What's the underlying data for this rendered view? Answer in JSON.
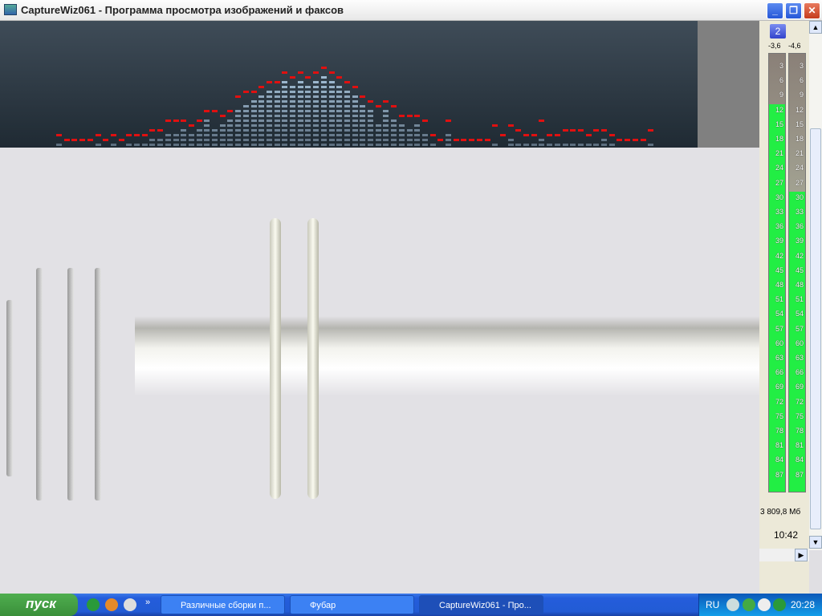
{
  "window": {
    "title": "CaptureWiz061 - Программа просмотра изображений и факсов"
  },
  "spectrum": {
    "peak_color": "#e01010",
    "bar_color": "#a8c4dc",
    "levels": [
      1,
      0,
      0,
      0,
      0,
      1,
      0,
      1,
      0,
      1,
      1,
      1,
      2,
      2,
      3,
      3,
      4,
      3,
      4,
      6,
      4,
      5,
      6,
      8,
      9,
      10,
      11,
      12,
      12,
      14,
      13,
      14,
      13,
      14,
      15,
      14,
      13,
      12,
      11,
      9,
      8,
      5,
      8,
      6,
      5,
      4,
      5,
      3,
      1,
      0,
      3,
      0,
      0,
      0,
      0,
      0,
      1,
      0,
      2,
      1,
      1,
      1,
      2,
      1,
      1,
      1,
      1,
      1,
      1,
      1,
      2,
      1,
      0,
      0,
      0,
      0,
      1
    ],
    "peaks": [
      2,
      1,
      1,
      1,
      1,
      2,
      1,
      2,
      1,
      2,
      2,
      2,
      3,
      3,
      5,
      5,
      5,
      4,
      5,
      7,
      7,
      6,
      7,
      10,
      11,
      11,
      12,
      13,
      13,
      15,
      14,
      15,
      14,
      15,
      16,
      15,
      14,
      13,
      12,
      10,
      9,
      8,
      9,
      8,
      6,
      6,
      6,
      5,
      2,
      1,
      5,
      1,
      1,
      1,
      1,
      1,
      4,
      2,
      4,
      3,
      2,
      2,
      5,
      2,
      2,
      3,
      3,
      3,
      2,
      3,
      3,
      2,
      1,
      1,
      1,
      1,
      3
    ]
  },
  "meter": {
    "badge": "2",
    "left_value": "-3,6",
    "right_value": "-4,6",
    "ticks": [
      "3",
      "6",
      "9",
      "12",
      "15",
      "18",
      "21",
      "24",
      "27",
      "30",
      "33",
      "36",
      "39",
      "42",
      "45",
      "48",
      "51",
      "54",
      "57",
      "60",
      "63",
      "66",
      "69",
      "72",
      "75",
      "78",
      "81",
      "84",
      "87"
    ],
    "left_fill_from": "12",
    "right_fill_from": "30",
    "fill_color": "#22ee44"
  },
  "status": {
    "disk": "3 809,8 Мб",
    "time": "10:42"
  },
  "taskbar": {
    "start": "пуск",
    "tasks": [
      "Различные сборки п...",
      "Фубар",
      "CaptureWiz061 - Про..."
    ],
    "lang": "RU",
    "clock": "20:28"
  }
}
